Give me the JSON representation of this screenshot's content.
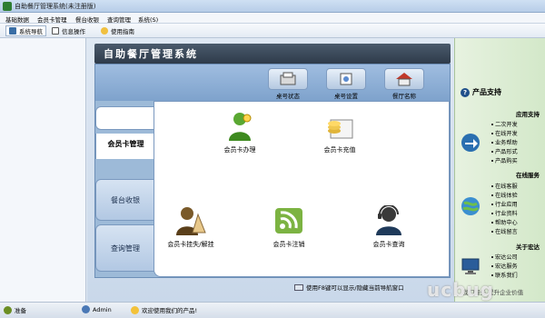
{
  "window": {
    "title": "自助餐厅管理系统(未注册版)"
  },
  "menu": [
    "基础数据",
    "会员卡管理",
    "餐台收银",
    "查询管理",
    "系统(S)"
  ],
  "toolbar": [
    {
      "label": "系统导航",
      "icon": "home-icon"
    },
    {
      "label": "信息操作",
      "icon": "info-icon"
    },
    {
      "label": "使用指南",
      "icon": "help-icon"
    }
  ],
  "system_title": "自助餐厅管理系统",
  "top_buttons": [
    {
      "label": "桌号状态",
      "icon": "table-status-icon"
    },
    {
      "label": "桌号设置",
      "icon": "table-settings-icon"
    },
    {
      "label": "餐厅名称",
      "icon": "restaurant-icon"
    }
  ],
  "tabs": [
    {
      "label": ""
    },
    {
      "label": "会员卡管理"
    },
    {
      "label": "餐台收银"
    },
    {
      "label": "查询管理"
    }
  ],
  "functions": [
    {
      "label": "会员卡办理",
      "icon": "member-card-new-icon"
    },
    {
      "label": "会员卡充值",
      "icon": "member-card-recharge-icon"
    },
    {
      "label": "会员卡挂失/解挂",
      "icon": "member-card-lost-icon"
    },
    {
      "label": "会员卡注销",
      "icon": "member-card-cancel-icon"
    },
    {
      "label": "会员卡查询",
      "icon": "member-card-query-icon"
    }
  ],
  "hint": "使用F8键可以显示/隐藏当前导航窗口",
  "right_panel": {
    "title": "产品支持",
    "sections": [
      {
        "heading": "应用支持",
        "icon": "arrow-icon",
        "items": [
          "二次开发",
          "在线开发",
          "业务帮助",
          "产品形式",
          "产品购买"
        ]
      },
      {
        "heading": "在线服务",
        "icon": "globe-icon",
        "items": [
          "在线客服",
          "在线体验",
          "行业应用",
          "行业资料",
          "帮助中心",
          "在线留言"
        ]
      },
      {
        "heading": "关于宏达",
        "icon": "monitor-icon",
        "items": [
          "宏达公司",
          "宏达服务",
          "联系我们"
        ]
      }
    ]
  },
  "right_footer": "我们服务 提升企业价值",
  "status": [
    {
      "text": "准备",
      "icon": "ready-icon"
    },
    {
      "text": "Admin",
      "icon": "user-icon"
    },
    {
      "text": "欢迎使用我们的产品!",
      "icon": "smile-icon"
    }
  ],
  "watermark": "ucbug",
  "colors": {
    "accent": "#2e7d32",
    "panel": "#9dbad8",
    "banner": "#2e3b4a"
  }
}
